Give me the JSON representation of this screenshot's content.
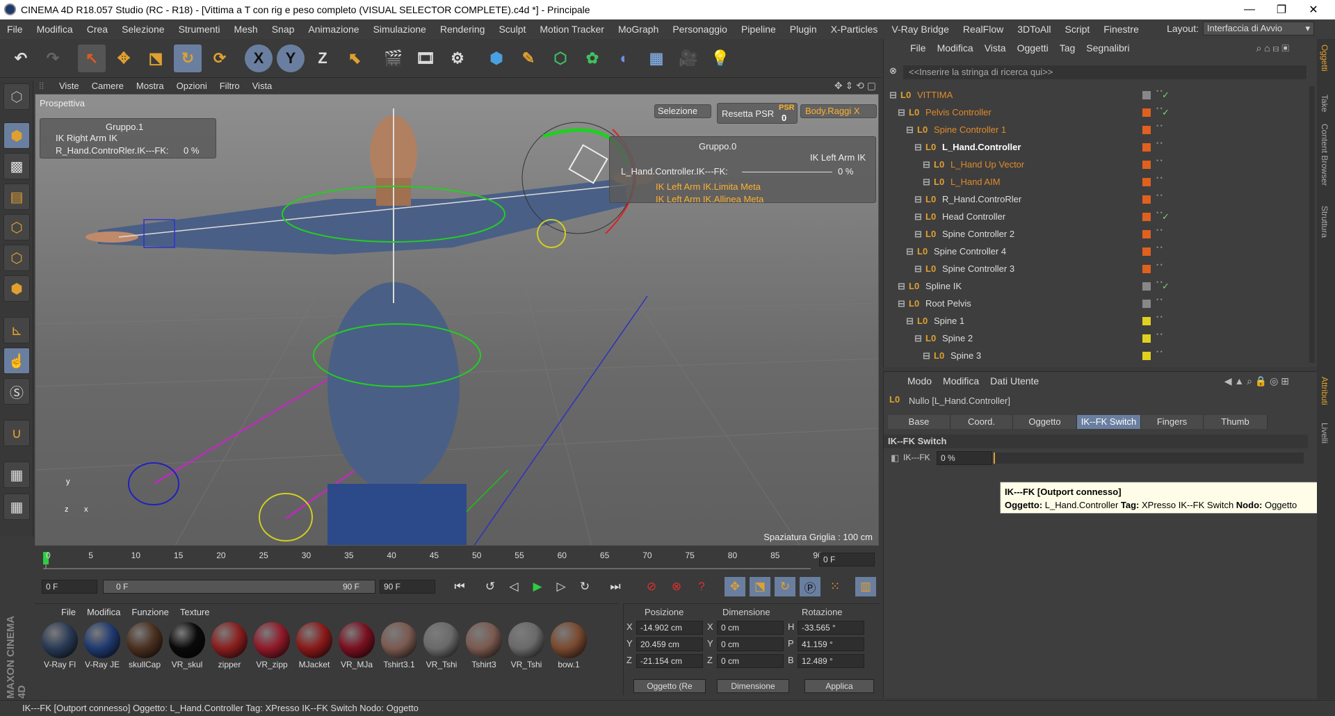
{
  "window": {
    "title": "CINEMA 4D R18.057 Studio (RC - R18) - [Vittima a T con rig e peso completo (VISUAL SELECTOR COMPLETE).c4d *] - Principale",
    "min": "—",
    "max": "❐",
    "close": "✕"
  },
  "menubar": [
    "File",
    "Modifica",
    "Crea",
    "Selezione",
    "Strumenti",
    "Mesh",
    "Snap",
    "Animazione",
    "Simulazione",
    "Rendering",
    "Sculpt",
    "Motion Tracker",
    "MoGraph",
    "Personaggio",
    "Pipeline",
    "Plugin",
    "X-Particles",
    "V-Ray Bridge",
    "RealFlow",
    "3DToAll",
    "Script",
    "Finestre"
  ],
  "layout": {
    "label": "Layout:",
    "value": "Interfaccia di Avvio"
  },
  "toolbar": {
    "x": "X",
    "y": "Y",
    "z": "Z"
  },
  "viewport": {
    "menu": [
      "Viste",
      "Camere",
      "Mostra",
      "Opzioni",
      "Filtro",
      "Vista"
    ],
    "label": "Prospettiva",
    "grid_spacing": "Spaziatura Griglia : 100 cm",
    "hud_left": {
      "group": "Gruppo.1",
      "ik_right": "IK Right Arm IK",
      "slider_label": "R_Hand.ControRler.IK---FK:",
      "slider_value": "0 %"
    },
    "hud_right": {
      "group": "Gruppo.0",
      "ik_left": "IK Left Arm IK",
      "slider_label": "L_Hand.Controller.IK---FK:",
      "slider_value": "0 %",
      "opt1": "IK Left Arm IK.Limita Meta",
      "opt2": "IK Left Arm IK.Allinea Meta"
    },
    "selezione": "Selezione",
    "reset_psr": "Resetta PSR",
    "psr_tag": "PSR",
    "psr_val": "0",
    "body_raggi": "Body.Raggi X"
  },
  "timeline": {
    "ticks": [
      "0",
      "5",
      "10",
      "15",
      "20",
      "25",
      "30",
      "35",
      "40",
      "45",
      "50",
      "55",
      "60",
      "65",
      "70",
      "75",
      "80",
      "85",
      "90"
    ],
    "frame_field": "0 F"
  },
  "transport": {
    "start": "0 F",
    "range_start": "0 F",
    "range_end": "90 F",
    "end": "90 F"
  },
  "materials": {
    "menu": [
      "File",
      "Modifica",
      "Funzione",
      "Texture"
    ],
    "items": [
      {
        "name": "V-Ray Fl",
        "color": "#2a3a55"
      },
      {
        "name": "V-Ray JE",
        "color": "#203a70"
      },
      {
        "name": "skullCap",
        "color": "#4a3020"
      },
      {
        "name": "VR_skul",
        "color": "#0a0a0a"
      },
      {
        "name": "zipper",
        "color": "#8a1e1e"
      },
      {
        "name": "VR_zipp",
        "color": "#901a2a"
      },
      {
        "name": "MJacket",
        "color": "#8a1a1a"
      },
      {
        "name": "VR_MJa",
        "color": "#7a1020"
      },
      {
        "name": "Tshirt3.1",
        "color": "#7a5a50"
      },
      {
        "name": "VR_Tshi",
        "color": "#6a6a6a"
      },
      {
        "name": "Tshirt3",
        "color": "#7a5a50"
      },
      {
        "name": "VR_Tshi",
        "color": "#6a6a6a"
      },
      {
        "name": "bow.1",
        "color": "#7a4a30"
      }
    ]
  },
  "coords": {
    "headers": [
      "Posizione",
      "Dimensione",
      "Rotazione"
    ],
    "rows": [
      {
        "axis": "X",
        "pos": "-14.902 cm",
        "dim_axis": "X",
        "dim": "0 cm",
        "rot_axis": "H",
        "rot": "-33.565 °"
      },
      {
        "axis": "Y",
        "pos": "20.459 cm",
        "dim_axis": "Y",
        "dim": "0 cm",
        "rot_axis": "P",
        "rot": "41.159 °"
      },
      {
        "axis": "Z",
        "pos": "-21.154 cm",
        "dim_axis": "Z",
        "dim": "0 cm",
        "rot_axis": "B",
        "rot": "12.489 °"
      }
    ],
    "btn_obj": "Oggetto (Re",
    "btn_dim": "Dimensione",
    "btn_apply": "Applica"
  },
  "objmgr": {
    "menu": [
      "File",
      "Modifica",
      "Vista",
      "Oggetti",
      "Tag",
      "Segnalibri"
    ],
    "search": "<<Inserire la stringa di ricerca qui>>",
    "rows": [
      {
        "name": "VITTIMA",
        "color": "#e08a2a",
        "tag": "#888"
      },
      {
        "name": "Pelvis Controller",
        "color": "#e08a2a",
        "tag": "#e06020"
      },
      {
        "name": "Spine Controller 1",
        "color": "#e08a2a",
        "tag": "#e06020"
      },
      {
        "name": "L_Hand.Controller",
        "color": "#ffffff",
        "tag": "#e06020"
      },
      {
        "name": "L_Hand Up Vector",
        "color": "#e08a2a",
        "tag": "#e06020"
      },
      {
        "name": "L_Hand AIM",
        "color": "#e08a2a",
        "tag": "#e06020"
      },
      {
        "name": "R_Hand.ControRler",
        "color": "#dddddd",
        "tag": "#e06020"
      },
      {
        "name": "Head Controller",
        "color": "#dddddd",
        "tag": "#e06020"
      },
      {
        "name": "Spine Controller 2",
        "color": "#dddddd",
        "tag": "#e06020"
      },
      {
        "name": "Spine Controller 4",
        "color": "#dddddd",
        "tag": "#e06020"
      },
      {
        "name": "Spine Controller 3",
        "color": "#dddddd",
        "tag": "#e06020"
      },
      {
        "name": "Spline IK",
        "color": "#dddddd",
        "tag": "#888"
      },
      {
        "name": "Root Pelvis",
        "color": "#dddddd",
        "tag": "#888"
      },
      {
        "name": "Spine 1",
        "color": "#dddddd",
        "tag": "#e0d020"
      },
      {
        "name": "Spine 2",
        "color": "#dddddd",
        "tag": "#e0d020"
      },
      {
        "name": "Spine 3",
        "color": "#dddddd",
        "tag": "#e0d020"
      }
    ]
  },
  "attr": {
    "menu": [
      "Modo",
      "Modifica",
      "Dati Utente"
    ],
    "object": "Nullo [L_Hand.Controller]",
    "tabs": [
      "Base",
      "Coord.",
      "Oggetto",
      "IK--FK Switch",
      "Fingers",
      "Thumb"
    ],
    "section": "IK--FK Switch",
    "field_label": "IK---FK",
    "field_value": "0 %"
  },
  "tooltip": {
    "line1": "IK---FK [Outport connesso]",
    "line2_a": "Oggetto:",
    "line2_b": " L_Hand.Controller ",
    "line2_c": "Tag:",
    "line2_d": " XPresso IK--FK Switch ",
    "line2_e": "Nodo:",
    "line2_f": " Oggetto"
  },
  "status": "IK---FK [Outport connesso] Oggetto: L_Hand.Controller Tag: XPresso IK--FK Switch Nodo: Oggetto",
  "righttabs": [
    "Oggetti",
    "Take",
    "Content Browser",
    "Struttura",
    "Attributi",
    "Livelli"
  ],
  "maxon": "MAXON CINEMA 4D"
}
